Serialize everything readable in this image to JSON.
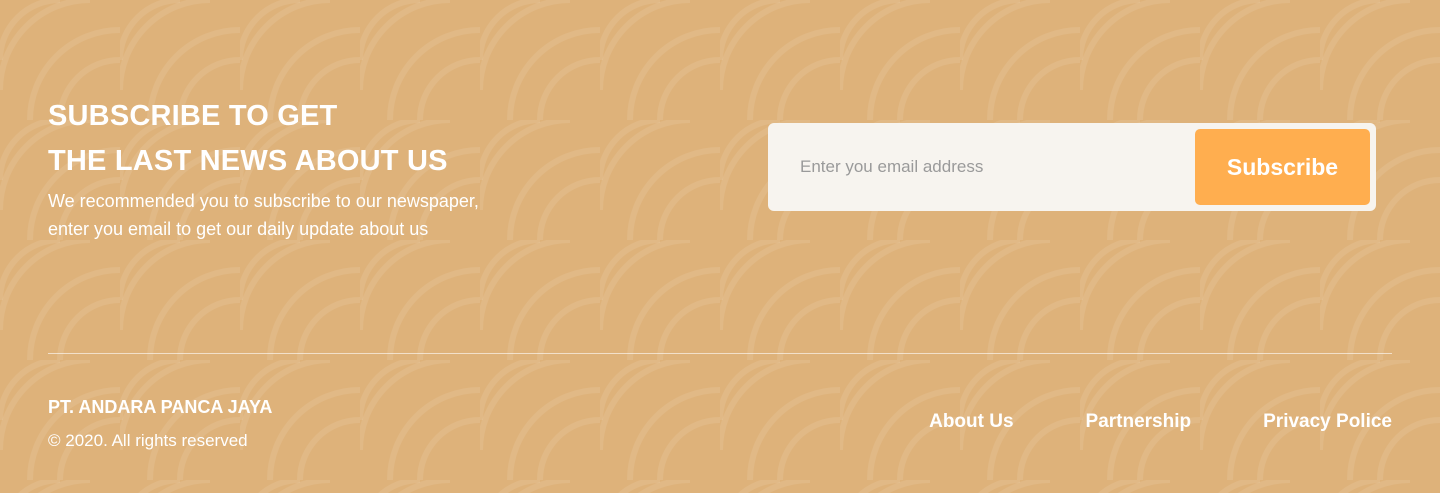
{
  "newsletter": {
    "headline_line1": "SUBSCRIBE TO GET",
    "headline_line2": "THE LAST NEWS ABOUT US",
    "description_line1": "We recommended you to subscribe to our newspaper,",
    "description_line2": "enter you email to get our daily update about us",
    "email_placeholder": "Enter you email address",
    "email_value": "",
    "subscribe_label": "Subscribe"
  },
  "footer": {
    "company_name": "PT. ANDARA PANCA JAYA",
    "copyright": "© 2020. All rights reserved",
    "links": [
      {
        "label": "About Us"
      },
      {
        "label": "Partnership"
      },
      {
        "label": "Privacy Police"
      }
    ]
  },
  "colors": {
    "background": "#DEB27A",
    "accent_button": "#FFAE4F",
    "form_background": "#F7F4EF",
    "text": "#FFFFFF"
  }
}
